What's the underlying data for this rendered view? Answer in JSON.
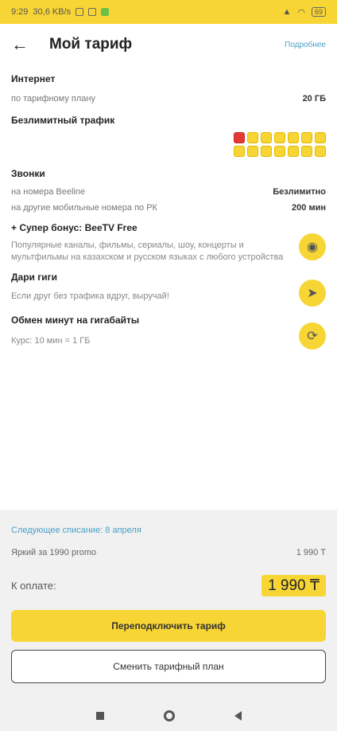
{
  "status_bar": {
    "time": "9:29",
    "speed": "30,6 KB/s",
    "battery": "69"
  },
  "header": {
    "title": "Мой тариф",
    "details_link": "Подробнее"
  },
  "internet": {
    "title": "Интернет",
    "plan_label": "по тарифному плану",
    "plan_value": "20 ГБ"
  },
  "unlimited": {
    "title": "Безлимитный трафик"
  },
  "calls": {
    "title": "Звонки",
    "beeline_label": "на номера Beeline",
    "beeline_value": "Безлимитно",
    "other_label": "на другие мобильные номера по РК",
    "other_value": "200 мин"
  },
  "bonus": {
    "title": "+ Супер бонус: BeeTV Free",
    "description": "Популярные каналы, фильмы, сериалы, шоу, концерты и мультфильмы на казахском и русском языках с любого устройства"
  },
  "gift": {
    "title": "Дари гиги",
    "description": "Если друг без трафика вдруг, выручай!"
  },
  "exchange": {
    "title": "Обмен минут на гигабайты",
    "description": "Курс: 10 мин = 1 ГБ"
  },
  "billing": {
    "next_charge": "Следующее списание: 8 апреля",
    "plan_name": "Яркий за 1990 promo",
    "plan_price": "1 990 Т",
    "to_pay_label": "К оплате:",
    "to_pay_amount": "1 990 ₸"
  },
  "buttons": {
    "reconnect": "Переподключить тариф",
    "change": "Сменить тарифный план"
  },
  "colors": {
    "accent": "#f7d534",
    "link": "#4a9fc7"
  }
}
